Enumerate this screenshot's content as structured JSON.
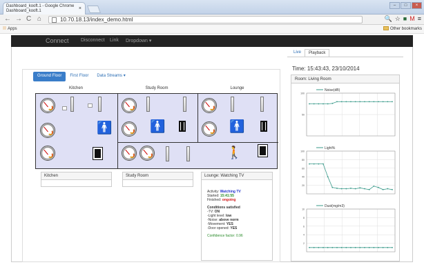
{
  "browser": {
    "tab_title": "Dashboard_kooft.1 - Google Chrome",
    "tab_subtitle": "Dashboard_kooft.1",
    "url": "10.70.18.13/index_demo.html",
    "apps_label": "Apps",
    "other_bookmarks": "Other bookmarks"
  },
  "navbar": {
    "brand": "Connect",
    "items": [
      "Disconnect",
      "Link",
      "Dropdown ▾"
    ]
  },
  "floor_tabs": [
    "Ground Floor",
    "First Floor",
    "Data Streams ▾"
  ],
  "rooms": [
    "Kitchen",
    "Study Room",
    "Lounge"
  ],
  "room_panels": {
    "kitchen": "Kitchen",
    "study": "Study Room",
    "lounge": "Lounge: Watching TV"
  },
  "lounge_details": {
    "activity_label": "Activity:",
    "activity_value": "Watching TV",
    "started_label": "Started:",
    "started_value": "15:41:55",
    "finished_label": "Finished:",
    "finished_value": "ongoing",
    "conditions_title": "Conditions satisfied",
    "conditions": [
      {
        "label": "-TV:",
        "value": "ON"
      },
      {
        "label": "-Light level:",
        "value": "low"
      },
      {
        "label": "-Noise:",
        "value": "above norm"
      },
      {
        "label": "-Movement:",
        "value": "YES"
      },
      {
        "label": "-Door opened:",
        "value": "YES"
      }
    ],
    "confidence": "Confidence factor: 0.96"
  },
  "right_tabs": [
    "Live",
    "Playback"
  ],
  "time_text": "Time: 15:43:43, 23/10/2014",
  "room_title": "Room: Living Room",
  "chart_data": [
    {
      "type": "line",
      "series": [
        {
          "name": "Noise(dB)",
          "values": [
            75,
            75,
            75,
            75,
            75,
            76,
            80,
            80,
            80,
            80,
            80,
            80,
            80,
            80,
            80,
            80,
            80,
            80,
            80
          ]
        }
      ],
      "ylim": [
        0,
        100
      ],
      "yticks": [
        50,
        100
      ],
      "color": "#3a9a8a"
    },
    {
      "type": "line",
      "series": [
        {
          "name": "Light%",
          "values": [
            70,
            70,
            70,
            70,
            40,
            15,
            13,
            12,
            12,
            13,
            12,
            14,
            12,
            10,
            18,
            15,
            10,
            12,
            10
          ]
        }
      ],
      "ylim": [
        0,
        100
      ],
      "yticks": [
        20,
        40,
        60,
        80,
        100
      ],
      "color": "#3a9a8a"
    },
    {
      "type": "line",
      "series": [
        {
          "name": "Dust(mg/m3)",
          "values": [
            1,
            1,
            1,
            1,
            1,
            1,
            1,
            1,
            1,
            1,
            1,
            1,
            1,
            1,
            1,
            1,
            1,
            1,
            1
          ]
        }
      ],
      "ylim": [
        0,
        10
      ],
      "yticks": [
        2,
        4,
        6,
        8,
        10
      ],
      "color": "#3a9a8a"
    }
  ]
}
